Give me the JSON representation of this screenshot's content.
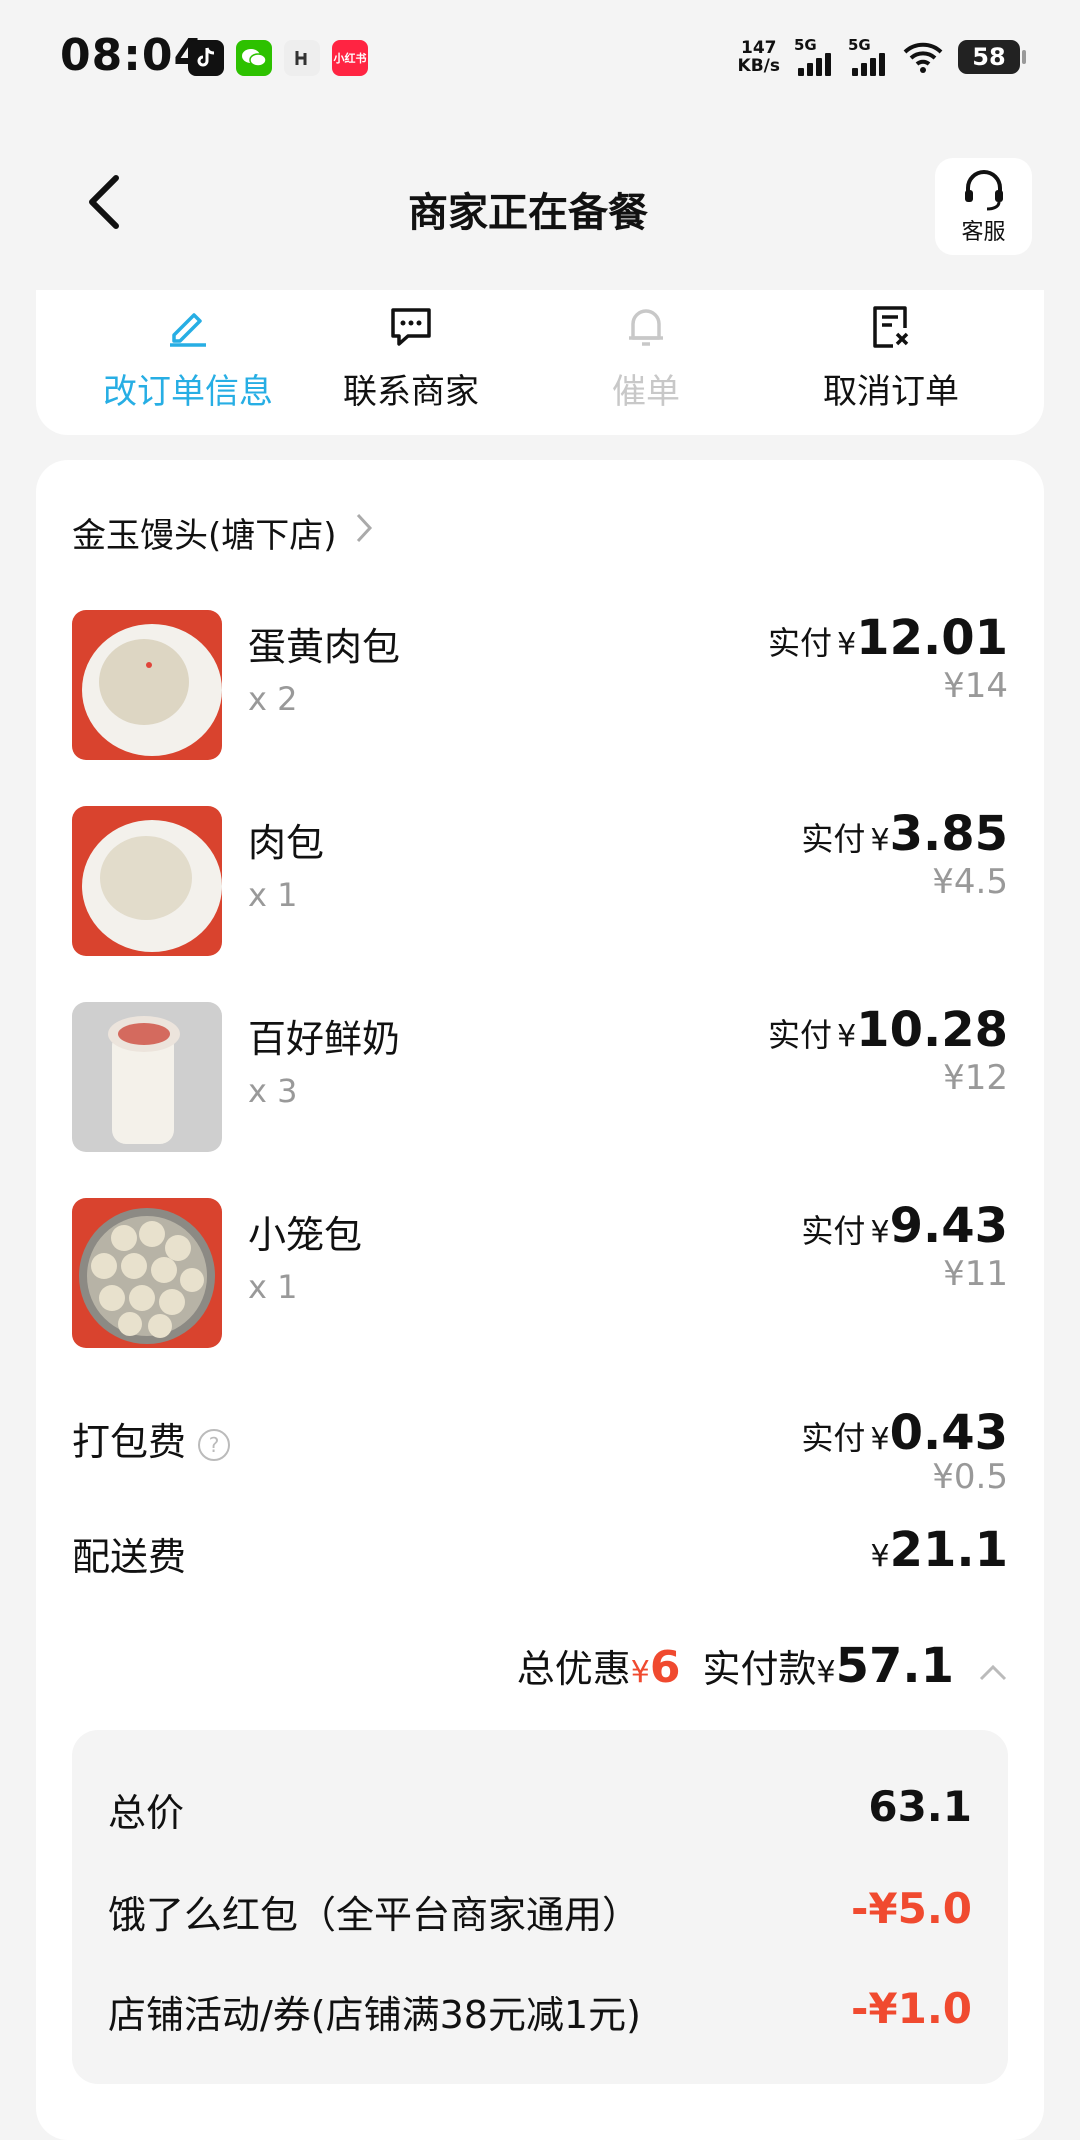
{
  "status_bar": {
    "time": "08:04",
    "app_icons": [
      "tiktok-icon",
      "wechat-icon",
      "hupu-icon",
      "xiaohongshu-icon"
    ],
    "xiaohongshu_label": "小红书",
    "net_speed_value": "147",
    "net_speed_unit": "KB/s",
    "signal1_label": "5G",
    "signal2_label": "5G",
    "battery": "58"
  },
  "header": {
    "title": "商家正在备餐",
    "service_label": "客服"
  },
  "actions": [
    {
      "label": "改订单信息",
      "icon": "edit-icon",
      "color": "#27aee4"
    },
    {
      "label": "联系商家",
      "icon": "chat-icon",
      "color": "#111111"
    },
    {
      "label": "催单",
      "icon": "bell-icon",
      "color": "#c8c8c8"
    },
    {
      "label": "取消订单",
      "icon": "cancel-order-icon",
      "color": "#111111"
    }
  ],
  "order": {
    "shop_name": "金玉馒头(塘下店)",
    "paid_label": "实付",
    "currency": "¥",
    "items": [
      {
        "name": "蛋黄肉包",
        "qty": "x 2",
        "paid": "12.01",
        "original": "¥14"
      },
      {
        "name": "肉包",
        "qty": "x 1",
        "paid": "3.85",
        "original": "¥4.5"
      },
      {
        "name": "百好鲜奶",
        "qty": "x 3",
        "paid": "10.28",
        "original": "¥12"
      },
      {
        "name": "小笼包",
        "qty": "x 1",
        "paid": "9.43",
        "original": "¥11"
      }
    ],
    "packing_fee": {
      "label": "打包费",
      "paid": "0.43",
      "original": "¥0.5"
    },
    "delivery_fee": {
      "label": "配送费",
      "amount": "21.1"
    },
    "summary": {
      "discount_label": "总优惠",
      "discount_amount": "6",
      "total_label": "实付款",
      "total_amount": "57.1"
    },
    "breakdown": [
      {
        "label": "总价",
        "value": "63.1"
      },
      {
        "label": "饿了么红包（全平台商家通用）",
        "value": "-¥5.0"
      },
      {
        "label": "店铺活动/券(店铺满38元减1元)",
        "value": "-¥1.0"
      }
    ]
  },
  "colors": {
    "accent": "#27aee4",
    "discount": "#f04a2f"
  }
}
